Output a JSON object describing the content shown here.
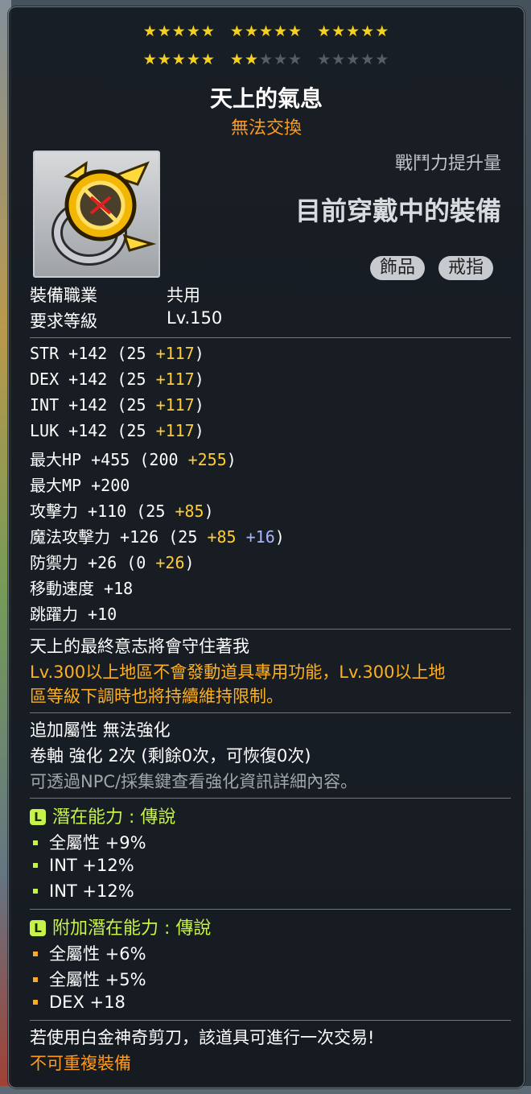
{
  "stars": {
    "filled": 22,
    "total": 30
  },
  "item": {
    "name": "天上的氣息",
    "trade": "無法交換",
    "icon": "ring-icon"
  },
  "combat": {
    "label": "戰鬥力提升量",
    "message": "目前穿戴中的裝備"
  },
  "tags": [
    "飾品",
    "戒指"
  ],
  "requirements": [
    {
      "label": "裝備職業",
      "value": "共用"
    },
    {
      "label": "要求等級",
      "value": "Lv.150"
    }
  ],
  "stats": [
    {
      "name": "STR",
      "total": "+142",
      "base": "(25",
      "bonus": "+117",
      "extra": "",
      "close": ")"
    },
    {
      "name": "DEX",
      "total": "+142",
      "base": "(25",
      "bonus": "+117",
      "extra": "",
      "close": ")"
    },
    {
      "name": "INT",
      "total": "+142",
      "base": "(25",
      "bonus": "+117",
      "extra": "",
      "close": ")"
    },
    {
      "name": "LUK",
      "total": "+142",
      "base": "(25",
      "bonus": "+117",
      "extra": "",
      "close": ")"
    },
    {
      "name": "最大HP",
      "total": "+455",
      "base": "(200",
      "bonus": "+255",
      "extra": "",
      "close": ")"
    },
    {
      "name": "最大MP",
      "total": "+200",
      "base": "",
      "bonus": "",
      "extra": "",
      "close": ""
    },
    {
      "name": "攻擊力",
      "total": "+110",
      "base": "(25",
      "bonus": "+85",
      "extra": "",
      "close": ")"
    },
    {
      "name": "魔法攻擊力",
      "total": "+126",
      "base": "(25",
      "bonus": "+85",
      "extra": "+16",
      "close": ")"
    },
    {
      "name": "防禦力",
      "total": "+26",
      "base": "(0",
      "bonus": "+26",
      "extra": "",
      "close": ")"
    },
    {
      "name": "移動速度",
      "total": "+18",
      "base": "",
      "bonus": "",
      "extra": "",
      "close": ""
    },
    {
      "name": "跳躍力",
      "total": "+10",
      "base": "",
      "bonus": "",
      "extra": "",
      "close": ""
    }
  ],
  "description": {
    "flavor": "天上的最終意志將會守住著我",
    "restriction_1": "Lv.300以上地區不會發動道具專用功能，Lv.300以上地",
    "restriction_2": "區等級下調時也將持續維持限制。"
  },
  "enhance": {
    "flame": "追加屬性 無法強化",
    "scroll": "卷軸 強化 2次 (剩餘0次，可恢復0次)",
    "hint": "可透過NPC/採集鍵查看強化資訊詳細內容。"
  },
  "potential": {
    "badge": "L",
    "title": "潛在能力 : 傳說",
    "lines": [
      "全屬性 +9%",
      "INT +12%",
      "INT +12%"
    ]
  },
  "bonus_potential": {
    "badge": "L",
    "title": "附加潛在能力 : 傳說",
    "lines": [
      "全屬性 +6%",
      "全屬性 +5%",
      "DEX +18"
    ]
  },
  "footer": {
    "note": "若使用白金神奇剪刀，該道具可進行一次交易!",
    "warning": "不可重複裝備"
  },
  "colors": {
    "star_on": "#f5d11e",
    "bonus": "#ffcc33",
    "magic_extra": "#a8b4ff",
    "potential": "#c6f24a",
    "trade": "#ff9a1a"
  }
}
